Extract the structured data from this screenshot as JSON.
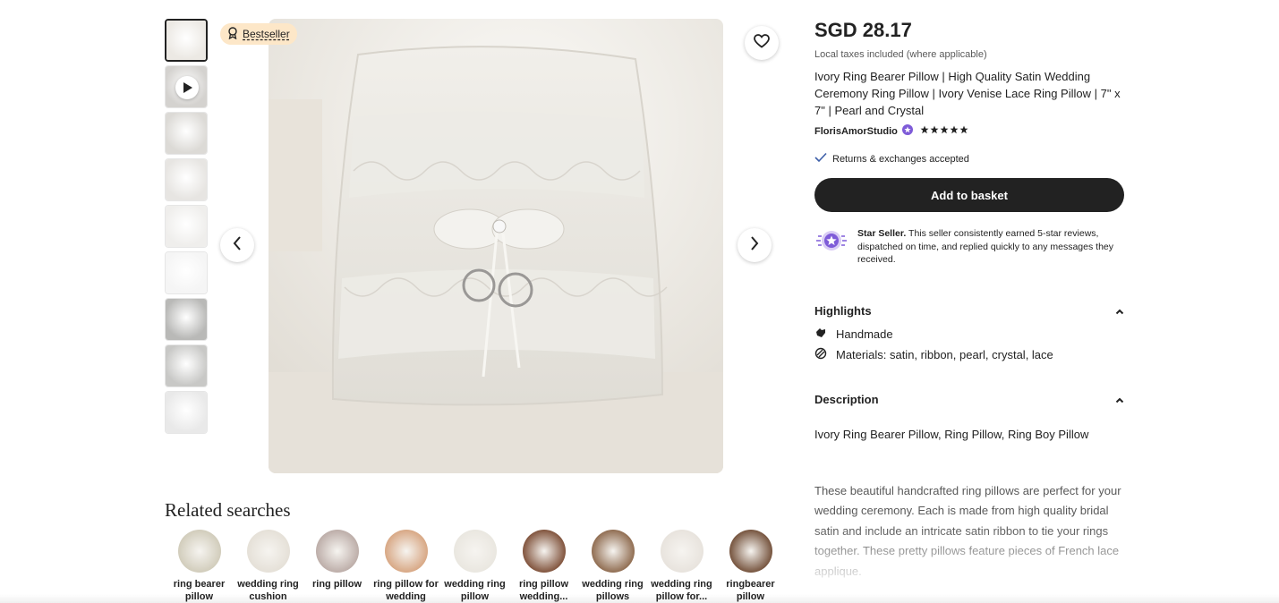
{
  "badge": {
    "label": "Bestseller",
    "icon": "award-ribbon-icon"
  },
  "gallery": {
    "thumbnails": [
      {
        "kind": "image",
        "tone": "#ece9e4"
      },
      {
        "kind": "video",
        "tone": "#d4d2cf"
      },
      {
        "kind": "image",
        "tone": "#dcdad6"
      },
      {
        "kind": "image",
        "tone": "#e7e5e2"
      },
      {
        "kind": "image",
        "tone": "#efeeec"
      },
      {
        "kind": "image",
        "tone": "#f5f5f5"
      },
      {
        "kind": "image",
        "tone": "#b9b9b7"
      },
      {
        "kind": "image",
        "tone": "#c8c8c6"
      },
      {
        "kind": "image",
        "tone": "#e9e9e9"
      }
    ]
  },
  "product": {
    "price": "SGD 28.17",
    "tax_note": "Local taxes included (where applicable)",
    "title": "Ivory Ring Bearer Pillow | High Quality Satin Wedding Ceremony Ring Pillow | Ivory Venise Lace Ring Pillow | 7\" x 7\" | Pearl and Crystal",
    "seller": "FlorisAmorStudio",
    "rating_stars": 5,
    "returns": "Returns & exchanges accepted",
    "add_to_basket": "Add to basket"
  },
  "star_seller": {
    "heading": "Star Seller.",
    "text": " This seller consistently earned 5-star reviews, dispatched on time, and replied quickly to any messages they received."
  },
  "highlights": {
    "heading": "Highlights",
    "items": [
      {
        "icon": "hand-icon",
        "label": "Handmade"
      },
      {
        "icon": "materials-icon",
        "label": "Materials: satin, ribbon, pearl, crystal, lace"
      }
    ]
  },
  "description": {
    "heading": "Description",
    "summary": "Ivory Ring Bearer Pillow, Ring Pillow, Ring Boy Pillow",
    "body": "These beautiful handcrafted ring pillows are perfect for your wedding ceremony. Each is made from high quality bridal satin and include an intricate satin ribbon to tie your rings together. These pretty pillows feature pieces of French lace applique."
  },
  "related": {
    "heading": "Related searches",
    "items": [
      {
        "label": "ring bearer pillow",
        "tone": "#cfcab8"
      },
      {
        "label": "wedding ring cushion",
        "tone": "#e4dfd6"
      },
      {
        "label": "ring pillow",
        "tone": "#b9a9a4"
      },
      {
        "label": "ring pillow for wedding",
        "tone": "#d6a37e"
      },
      {
        "label": "wedding ring pillow",
        "tone": "#e9e6df"
      },
      {
        "label": "ring pillow wedding...",
        "tone": "#7a4a32"
      },
      {
        "label": "wedding ring pillows",
        "tone": "#8a6548"
      },
      {
        "label": "wedding ring pillow for...",
        "tone": "#e7e2dc"
      },
      {
        "label": "ringbearer pillow",
        "tone": "#6e4a33"
      }
    ]
  }
}
